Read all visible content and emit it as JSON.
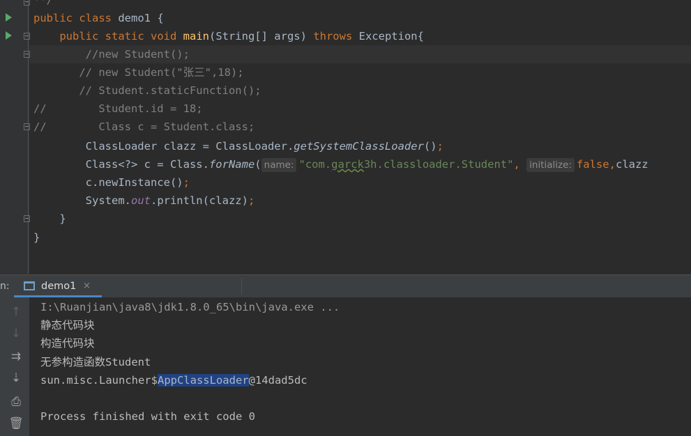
{
  "editor": {
    "code_lines": [
      {
        "id": "l0",
        "segments": [
          {
            "t": "**/",
            "c": "cm"
          }
        ]
      },
      {
        "id": "l1",
        "segments": [
          {
            "t": "public ",
            "c": "kw"
          },
          {
            "t": "class ",
            "c": "kw"
          },
          {
            "t": "demo1 {",
            "c": ""
          }
        ]
      },
      {
        "id": "l2",
        "segments": [
          {
            "t": "    public ",
            "c": "kw"
          },
          {
            "t": "static ",
            "c": "kw"
          },
          {
            "t": "void ",
            "c": "kw"
          },
          {
            "t": "main",
            "c": "fn"
          },
          {
            "t": "(String[] args) ",
            "c": ""
          },
          {
            "t": "throws ",
            "c": "kw"
          },
          {
            "t": "Exception{",
            "c": ""
          }
        ]
      },
      {
        "id": "l3",
        "segments": [
          {
            "t": "        //new Student();",
            "c": "cm"
          }
        ]
      },
      {
        "id": "l4",
        "segments": [
          {
            "t": "       // new Student(\"张三\",18);",
            "c": "cm"
          }
        ]
      },
      {
        "id": "l5",
        "segments": [
          {
            "t": "       // Student.staticFunction();",
            "c": "cm"
          }
        ]
      },
      {
        "id": "l6",
        "segments": [
          {
            "t": "//        Student.id = 18;",
            "c": "cm"
          }
        ]
      },
      {
        "id": "l7",
        "segments": [
          {
            "t": "//        Class c = Student.class;",
            "c": "cm"
          }
        ]
      },
      {
        "id": "l8",
        "segments": [
          {
            "t": "        ClassLoader clazz = ClassLoader.",
            "c": ""
          },
          {
            "t": "getSystemClassLoader",
            "c": "it"
          },
          {
            "t": "()",
            "c": ""
          },
          {
            "t": ";",
            "c": "kw"
          }
        ]
      },
      {
        "id": "l9",
        "segments": [
          {
            "t": "        Class<?> c = Class.",
            "c": ""
          },
          {
            "t": "forName",
            "c": "it"
          },
          {
            "t": "(",
            "c": ""
          },
          {
            "t": "name:",
            "c": "hint"
          },
          {
            "t": "\"com.",
            "c": "str"
          },
          {
            "t": "garck",
            "c": "str wavy"
          },
          {
            "t": "3h.classloader.Student\"",
            "c": "str"
          },
          {
            "t": ", ",
            "c": "kw"
          },
          {
            "t": "initialize:",
            "c": "hint"
          },
          {
            "t": "false",
            "c": "kw"
          },
          {
            "t": ",",
            "c": "kw"
          },
          {
            "t": "clazz",
            "c": ""
          }
        ]
      },
      {
        "id": "l10",
        "segments": [
          {
            "t": "        c.newInstance()",
            "c": ""
          },
          {
            "t": ";",
            "c": "kw"
          }
        ]
      },
      {
        "id": "l11",
        "segments": [
          {
            "t": "        System.",
            "c": ""
          },
          {
            "t": "out",
            "c": "st-it"
          },
          {
            "t": ".println(clazz)",
            "c": ""
          },
          {
            "t": ";",
            "c": "kw"
          }
        ]
      },
      {
        "id": "l12",
        "segments": [
          {
            "t": "    }",
            "c": ""
          }
        ]
      },
      {
        "id": "l13",
        "segments": [
          {
            "t": "}",
            "c": ""
          }
        ]
      }
    ]
  },
  "run_window": {
    "label": "n:",
    "tab_label": "demo1",
    "tab_close": "×"
  },
  "toolbar": {
    "icons": [
      {
        "name": "up-arrow-icon",
        "glyph": "↑",
        "dim": true
      },
      {
        "name": "down-arrow-icon",
        "glyph": "↓",
        "dim": true
      },
      {
        "name": "soft-wrap-icon",
        "glyph": "⇉",
        "dim": false
      },
      {
        "name": "scroll-to-end-icon",
        "glyph": "⇣",
        "dim": false
      },
      {
        "name": "print-icon",
        "glyph": "⎙",
        "dim": false
      },
      {
        "name": "trash-icon",
        "glyph": "🗑",
        "dim": false
      }
    ]
  },
  "console": {
    "java_path": "I:\\Ruanjian\\java8\\jdk1.8.0_65\\bin\\java.exe ...",
    "output1": "静态代码块",
    "output2": "构造代码块",
    "output3": "无参构造函数Student",
    "loader_prefix": "sun.misc.Launcher$",
    "loader_selected": "AppClassLoader",
    "loader_suffix": "@14dad5dc",
    "exit_message": "Process finished with exit code 0"
  }
}
